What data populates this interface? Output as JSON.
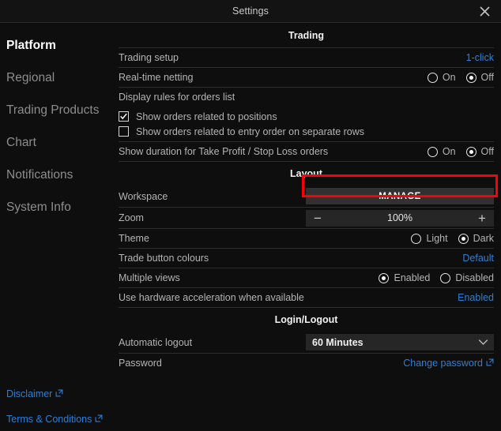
{
  "window": {
    "title": "Settings",
    "close_icon": "close-icon"
  },
  "sidebar": {
    "items": [
      {
        "label": "Platform",
        "active": true
      },
      {
        "label": "Regional",
        "active": false
      },
      {
        "label": "Trading Products",
        "active": false
      },
      {
        "label": "Chart",
        "active": false
      },
      {
        "label": "Notifications",
        "active": false
      },
      {
        "label": "System Info",
        "active": false
      }
    ],
    "footer_links": [
      {
        "label": "Disclaimer",
        "icon": "external-link-icon"
      },
      {
        "label": "Terms & Conditions",
        "icon": "external-link-icon"
      }
    ]
  },
  "sections": {
    "trading": {
      "title": "Trading",
      "trading_setup": {
        "label": "Trading setup",
        "value": "1-click"
      },
      "realtime_netting": {
        "label": "Real-time netting",
        "options": [
          {
            "label": "On",
            "selected": false
          },
          {
            "label": "Off",
            "selected": true
          }
        ]
      },
      "display_rules": {
        "label": "Display rules for orders list"
      },
      "checkboxes": [
        {
          "label": "Show orders related to positions",
          "checked": true
        },
        {
          "label": "Show orders related to entry order on separate rows",
          "checked": false
        }
      ],
      "tp_sl_duration": {
        "label": "Show duration for Take Profit / Stop Loss orders",
        "options": [
          {
            "label": "On",
            "selected": false
          },
          {
            "label": "Off",
            "selected": true
          }
        ]
      }
    },
    "layout": {
      "title": "Layout",
      "workspace": {
        "label": "Workspace",
        "button_label": "MANAGE",
        "highlighted": true
      },
      "zoom": {
        "label": "Zoom",
        "decrease": "−",
        "value": "100%",
        "increase": "+"
      },
      "theme": {
        "label": "Theme",
        "options": [
          {
            "label": "Light",
            "selected": false
          },
          {
            "label": "Dark",
            "selected": true
          }
        ]
      },
      "trade_button_colours": {
        "label": "Trade button colours",
        "value": "Default"
      },
      "multiple_views": {
        "label": "Multiple views",
        "options": [
          {
            "label": "Enabled",
            "selected": true
          },
          {
            "label": "Disabled",
            "selected": false
          }
        ]
      },
      "hardware_acceleration": {
        "label": "Use hardware acceleration when available",
        "value": "Enabled"
      }
    },
    "login_logout": {
      "title": "Login/Logout",
      "automatic_logout": {
        "label": "Automatic logout",
        "value": "60 Minutes",
        "icon": "chevron-down-icon"
      },
      "password": {
        "label": "Password",
        "value": "Change password",
        "icon": "external-link-icon"
      }
    }
  },
  "colors": {
    "accent_link": "#2d7fd3",
    "highlight": "#fb0007",
    "background": "#0e0e0e",
    "control_bg": "#262626",
    "button_bg": "#313131"
  }
}
